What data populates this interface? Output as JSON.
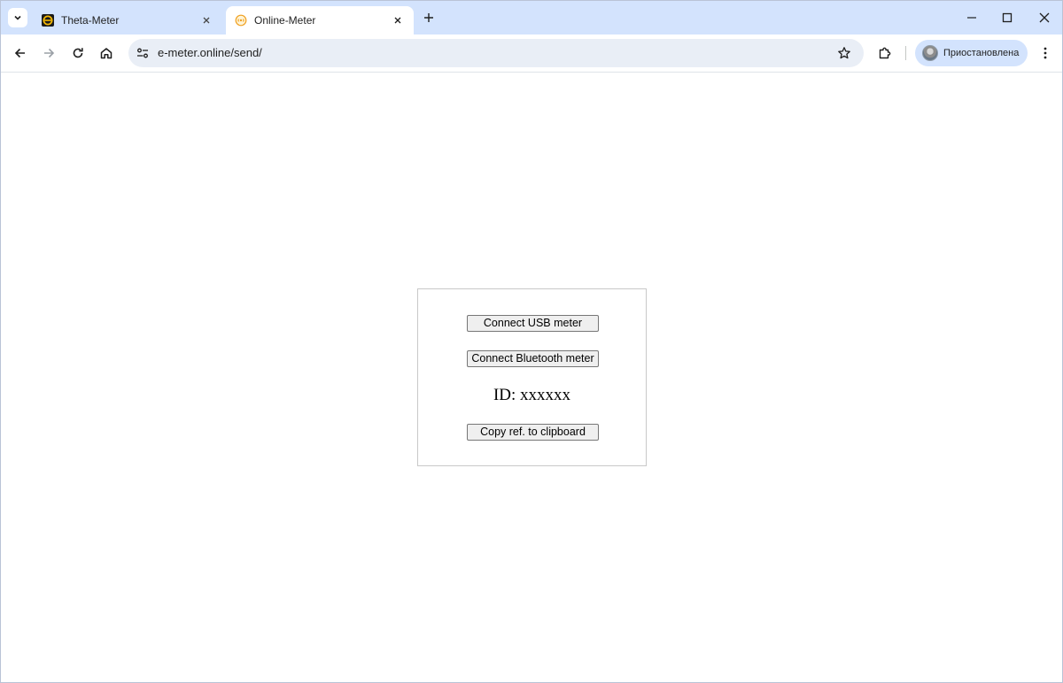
{
  "browser": {
    "tabs": [
      {
        "title": "Theta-Meter",
        "active": false,
        "favicon": "theta-meter-favicon"
      },
      {
        "title": "Online-Meter",
        "active": true,
        "favicon": "online-meter-favicon"
      }
    ],
    "address_bar": {
      "url": "e-meter.online/send/"
    },
    "profile": {
      "label": "Приостановлена"
    }
  },
  "page": {
    "connect_usb_label": "Connect USB meter",
    "connect_bluetooth_label": "Connect Bluetooth meter",
    "id_prefix": "ID:",
    "id_value": "xxxxxx",
    "copy_ref_label": "Copy ref. to clipboard"
  },
  "colors": {
    "tabstrip_bg": "#d3e3fd",
    "omnibox_bg": "#e9eef6",
    "theta_favicon": "#f2b705",
    "online_favicon": "#f0a020"
  }
}
